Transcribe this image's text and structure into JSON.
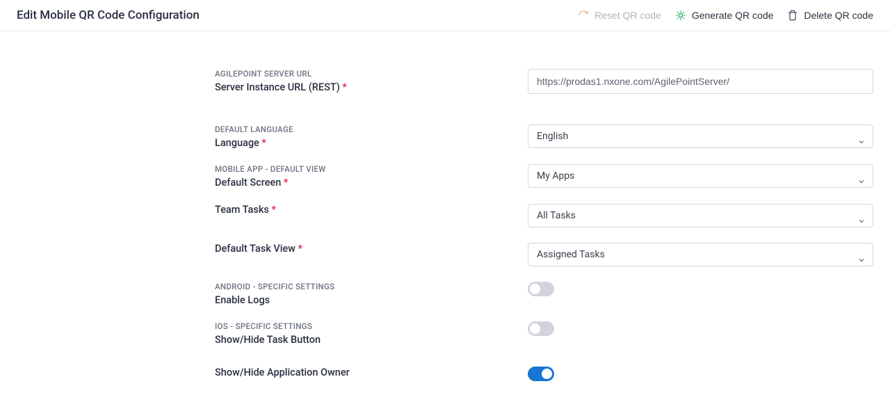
{
  "header": {
    "title": "Edit Mobile QR Code Configuration",
    "reset_label": "Reset QR code",
    "generate_label": "Generate QR code",
    "delete_label": "Delete QR code"
  },
  "sections": {
    "server_url_title": "AGILEPOINT SERVER URL",
    "server_url_label": "Server Instance URL (REST)",
    "server_url_value": "https://prodas1.nxone.com/AgilePointServer/",
    "language_title": "DEFAULT LANGUAGE",
    "language_label": "Language",
    "language_value": "English",
    "mobile_title": "MOBILE APP - DEFAULT VIEW",
    "default_screen_label": "Default Screen",
    "default_screen_value": "My Apps",
    "team_tasks_label": "Team Tasks",
    "team_tasks_value": "All Tasks",
    "default_task_view_label": "Default Task View",
    "default_task_view_value": "Assigned Tasks",
    "android_title": "ANDROID - SPECIFIC SETTINGS",
    "enable_logs_label": "Enable Logs",
    "enable_logs_value": false,
    "ios_title": "IOS - SPECIFIC SETTINGS",
    "show_task_button_label": "Show/Hide Task Button",
    "show_task_button_value": false,
    "show_app_owner_label": "Show/Hide Application Owner",
    "show_app_owner_value": true
  }
}
